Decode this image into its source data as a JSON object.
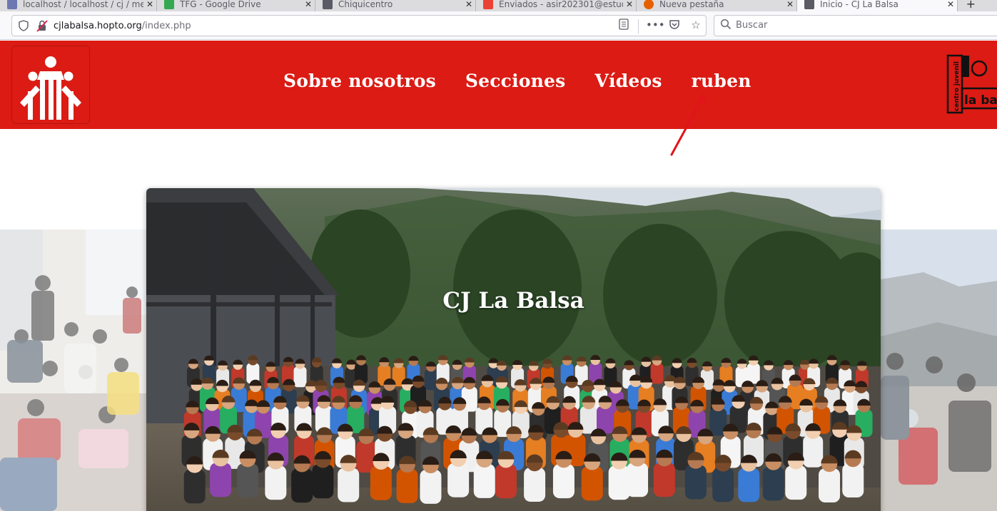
{
  "browser": {
    "tabs": [
      {
        "title": "localhost / localhost / cj / me",
        "favicon_color": "#6c78af"
      },
      {
        "title": "TFG - Google Drive",
        "favicon_color": "#34a853"
      },
      {
        "title": "Chiquicentro",
        "favicon_color": "#5b5b66"
      },
      {
        "title": "Enviados - asir202301@estud",
        "favicon_color": "#ea4335"
      },
      {
        "title": "Nueva pestaña",
        "favicon_color": "#e66000"
      },
      {
        "title": "Inicio - CJ La Balsa",
        "favicon_color": "#5b5b66"
      }
    ],
    "active_tab_index": 5,
    "url_host": "cjlabalsa.hopto.org",
    "url_path": "/index.php",
    "search_placeholder": "Buscar"
  },
  "site": {
    "brand_color": "#db1b14",
    "nav": [
      {
        "label": "Sobre nosotros"
      },
      {
        "label": "Secciones"
      },
      {
        "label": "Vídeos"
      },
      {
        "label": "ruben"
      }
    ],
    "right_logo": {
      "line1": "centro juvenil",
      "line2": "la balsa"
    },
    "hero_title": "CJ La Balsa"
  }
}
